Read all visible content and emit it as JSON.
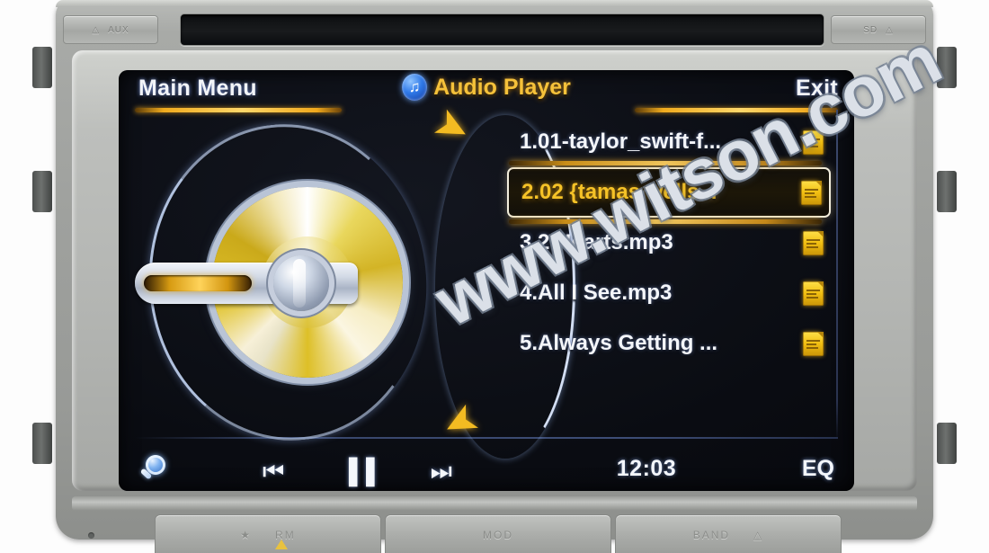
{
  "device": {
    "bezel": {
      "left_button_label": "AUX",
      "right_button_label": "SD",
      "cd_slot_name": "cd-slot"
    },
    "lower_buttons": [
      {
        "label": "RM"
      },
      {
        "label": "MOD"
      },
      {
        "label": "BAND"
      }
    ]
  },
  "screen": {
    "header": {
      "left_label": "Main Menu",
      "title": "Audio Player",
      "right_label": "Exit",
      "icon": "music-note-icon"
    },
    "disc": {
      "icon": "cd-disc-icon",
      "label": "CD"
    },
    "scroll": {
      "up_glyph": "➤",
      "down_glyph": "➤"
    },
    "playlist": [
      {
        "index": 1,
        "label": "1.01-taylor_swift-f...",
        "selected": false,
        "icon": "mp3-file-icon"
      },
      {
        "index": 2,
        "label": "2.02 {tamas wells...",
        "selected": true,
        "icon": "mp3-file-icon"
      },
      {
        "index": 3,
        "label": "3.2 Hearts.mp3",
        "selected": false,
        "icon": "mp3-file-icon"
      },
      {
        "index": 4,
        "label": "4.All I See.mp3",
        "selected": false,
        "icon": "mp3-file-icon"
      },
      {
        "index": 5,
        "label": "5.Always Getting ...",
        "selected": false,
        "icon": "mp3-file-icon"
      }
    ],
    "statusbar": {
      "search_icon": "magnifier-icon",
      "previous_glyph": "⏮",
      "pause_glyph": "▐▐",
      "next_glyph": "⏭",
      "clock": "12:03",
      "eq_label": "EQ"
    },
    "colors": {
      "accent_orange": "#f3bb22",
      "selected_text": "#f5c227",
      "text_white": "#f4f6fa",
      "screen_bg": "#0a0c12"
    }
  },
  "watermark": {
    "text": "www.witson.com"
  }
}
